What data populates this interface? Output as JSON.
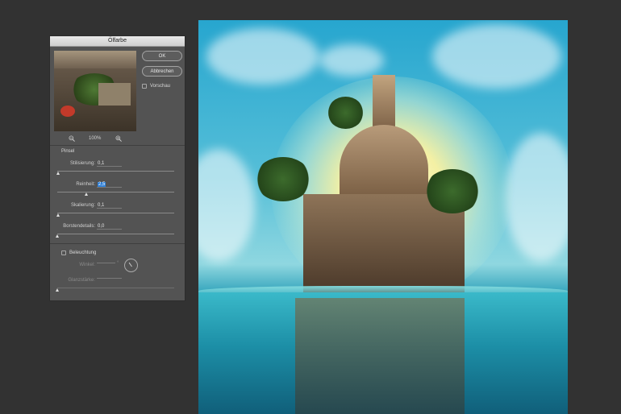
{
  "dialog": {
    "title": "Ölfarbe",
    "ok_label": "OK",
    "cancel_label": "Abbrechen",
    "preview_label": "Vorschau",
    "zoom_level": "100%",
    "zoom_out_icon": "zoom-out-icon",
    "zoom_in_icon": "zoom-in-icon",
    "brush_section": "Pinsel",
    "sliders": [
      {
        "label": "Stilisierung:",
        "value": "0,1",
        "fraction": 0.01
      },
      {
        "label": "Reinheit:",
        "value": "2,5",
        "fraction": 0.25
      },
      {
        "label": "Skalierung:",
        "value": "0,1",
        "fraction": 0.01
      },
      {
        "label": "Borstendetails:",
        "value": "0,0",
        "fraction": 0.0
      }
    ],
    "lighting_section": "Beleuchtung",
    "angle_label": "Winkel:",
    "angle_unit": "°",
    "gloss_label": "Glanzstärke:",
    "gloss_fraction": 0.0
  },
  "colors": {
    "dialog_bg": "#535353",
    "app_bg": "#323232",
    "selection": "#2f7fd6"
  }
}
